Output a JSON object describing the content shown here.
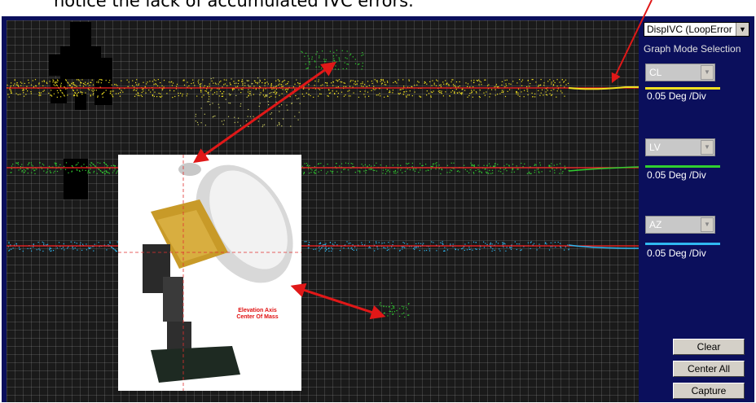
{
  "caption": "notice the lack of accumulated IVC errors.",
  "graph_mode": {
    "selected": "DispIVC (LoopError",
    "label": "Graph Mode Selection"
  },
  "axes": [
    {
      "name": "CL",
      "scale": "0.05 Deg /Div",
      "color": "#f0e020"
    },
    {
      "name": "LV",
      "scale": "0.05 Deg /Div",
      "color": "#30d030"
    },
    {
      "name": "AZ",
      "scale": "0.05 Deg /Div",
      "color": "#30b8f0"
    }
  ],
  "buttons": {
    "clear": "Clear",
    "center_all": "Center All",
    "capture": "Capture"
  },
  "photo": {
    "callout": "Elevation Axis Center Of Mass"
  },
  "colors": {
    "panel_bg": "#0b0f5c",
    "graph_bg": "#1a1a1a",
    "reference_line": "#ff2020",
    "arrow": "#e01818"
  }
}
